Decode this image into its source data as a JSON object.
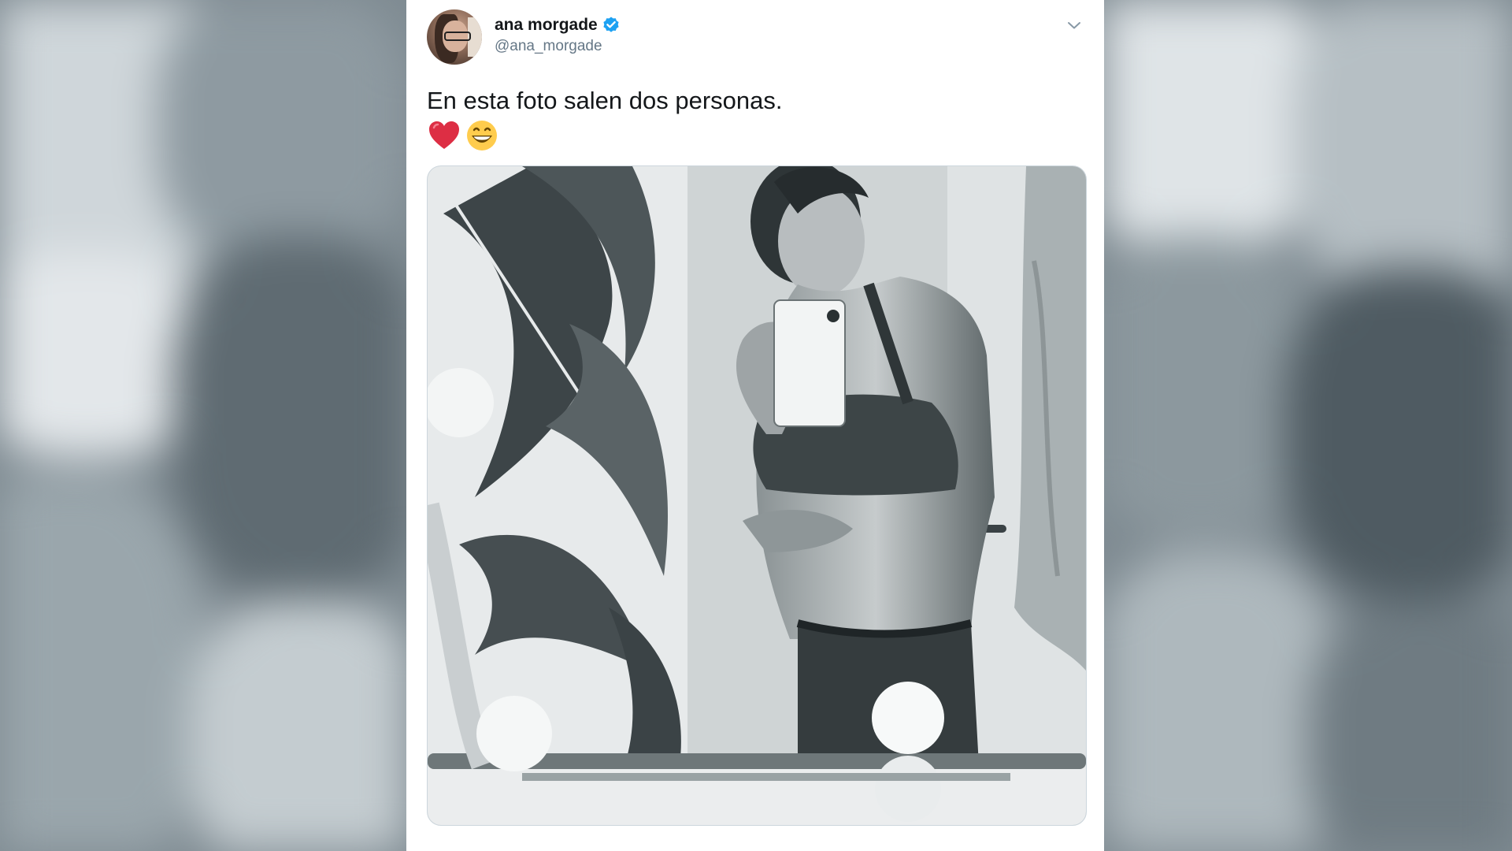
{
  "tweet": {
    "author": {
      "display_name": "ana morgade",
      "handle": "@ana_morgade",
      "verified": true
    },
    "text": "En esta foto salen dos personas.",
    "emojis": [
      "red-heart",
      "grinning-face-with-smiling-eyes"
    ],
    "media": {
      "description_icon": "photo-icon"
    },
    "footer_meta": ""
  },
  "colors": {
    "verified_blue": "#1da1f2",
    "card_bg": "#ffffff",
    "name_text": "#14171a",
    "secondary_text": "#657786",
    "background_blur": "#7f8b92"
  }
}
